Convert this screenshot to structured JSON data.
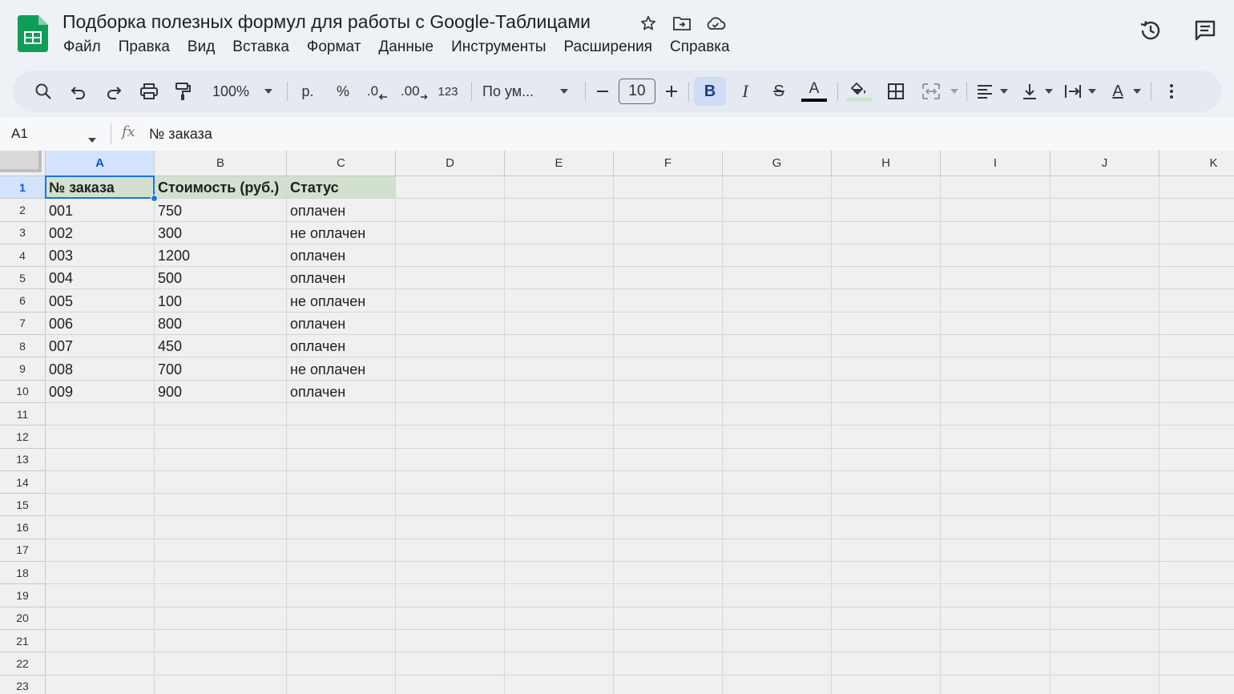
{
  "header": {
    "title": "Подборка полезных формул для работы с Google-Таблицами",
    "menu": [
      "Файл",
      "Правка",
      "Вид",
      "Вставка",
      "Формат",
      "Данные",
      "Инструменты",
      "Расширения",
      "Справка"
    ]
  },
  "toolbar": {
    "zoom": "100%",
    "currency": "р.",
    "percent": "%",
    "dec_decrease": ".0",
    "dec_increase": ".00",
    "number_format": "123",
    "font": "По ум...",
    "font_size": "10",
    "bold": "B",
    "italic": "I",
    "strike": "S",
    "text_color": "A",
    "text_rotate": "A"
  },
  "formula_bar": {
    "name_box": "A1",
    "fx": "fx",
    "value": "№ заказа"
  },
  "grid": {
    "columns": [
      "A",
      "B",
      "C",
      "D",
      "E",
      "F",
      "G",
      "H",
      "I",
      "J",
      "K"
    ],
    "rows": [
      "1",
      "2",
      "3",
      "4",
      "5",
      "6",
      "7",
      "8",
      "9",
      "10",
      "11",
      "12",
      "13",
      "14",
      "15",
      "16",
      "17",
      "18",
      "19",
      "20",
      "21",
      "22",
      "23"
    ],
    "headers": [
      "№ заказа",
      "Стоимость (руб.)",
      "Статус"
    ],
    "data": [
      [
        "001",
        "750",
        "оплачен"
      ],
      [
        "002",
        "300",
        "не оплачен"
      ],
      [
        "003",
        "1200",
        "оплачен"
      ],
      [
        "004",
        "500",
        "оплачен"
      ],
      [
        "005",
        "100",
        "не оплачен"
      ],
      [
        "006",
        "800",
        "оплачен"
      ],
      [
        "007",
        "450",
        "оплачен"
      ],
      [
        "008",
        "700",
        "не оплачен"
      ],
      [
        "009",
        "900",
        "оплачен"
      ]
    ],
    "selected_cell": "A1"
  },
  "colors": {
    "accent": "#1a73e8",
    "header_fill": "#d2e1cf",
    "sheets_green": "#0f9d58"
  }
}
